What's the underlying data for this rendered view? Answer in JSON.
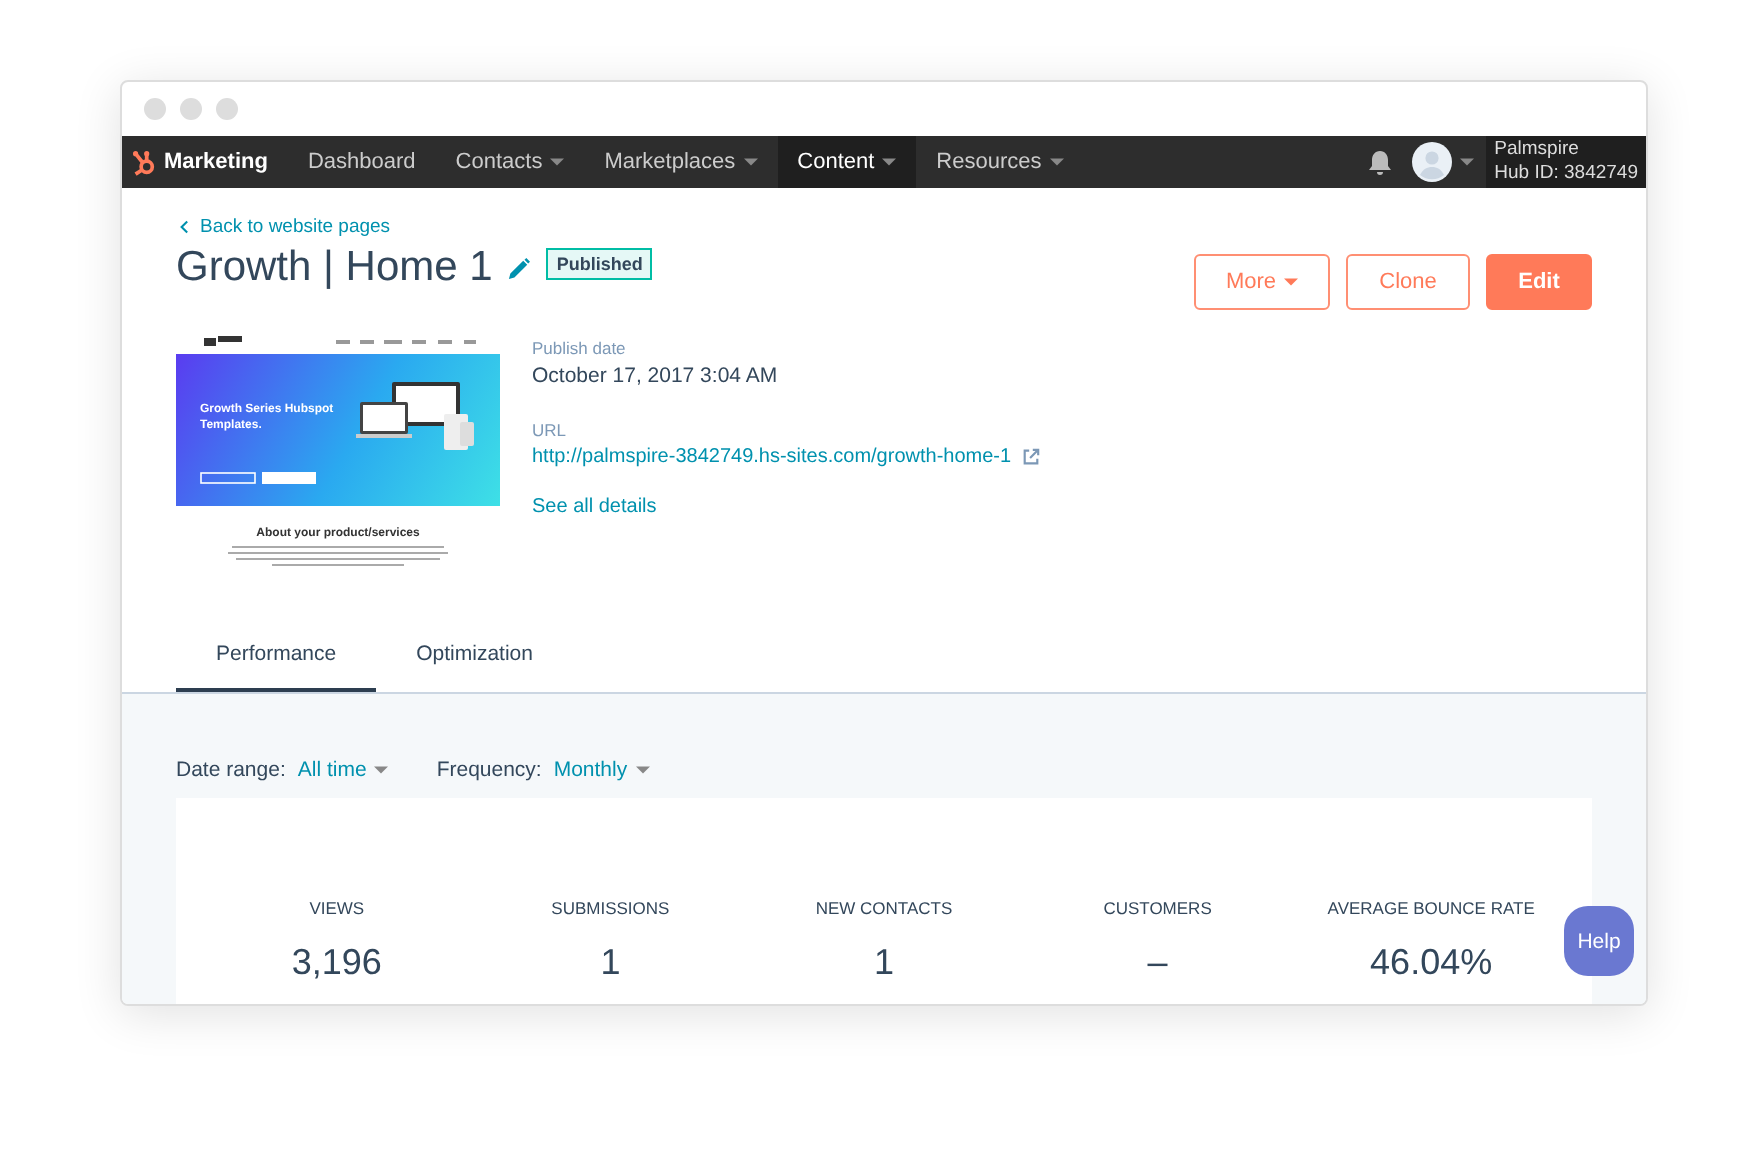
{
  "nav": {
    "brand": "Marketing",
    "items": [
      {
        "label": "Dashboard",
        "dropdown": false,
        "selected": false
      },
      {
        "label": "Contacts",
        "dropdown": true,
        "selected": false
      },
      {
        "label": "Marketplaces",
        "dropdown": true,
        "selected": false
      },
      {
        "label": "Content",
        "dropdown": true,
        "selected": true
      },
      {
        "label": "Resources",
        "dropdown": true,
        "selected": false
      }
    ],
    "account": {
      "name": "Palmspire",
      "hub_id": "Hub ID: 3842749"
    }
  },
  "back_link": "Back to website pages",
  "page_title": "Growth | Home 1",
  "status_badge": "Published",
  "actions": [
    {
      "label": "More",
      "kind": "dropdown"
    },
    {
      "label": "Clone",
      "kind": "secondary"
    },
    {
      "label": "Edit",
      "kind": "primary"
    }
  ],
  "preview": {
    "headline": "Growth Series Hubspot Templates.",
    "section_title": "About your product/services"
  },
  "details": [
    {
      "label": "Publish date",
      "value": "October 17, 2017 3:04 AM",
      "kind": "text"
    },
    {
      "label": "URL",
      "value": "http://palmspire-3842749.hs-sites.com/growth-home-1",
      "kind": "link"
    }
  ],
  "see_all": "See all details",
  "tabs": [
    {
      "label": "Performance",
      "selected": true
    },
    {
      "label": "Optimization",
      "selected": false
    }
  ],
  "filters": [
    {
      "label": "Date range:",
      "value": "All time"
    },
    {
      "label": "Frequency:",
      "value": "Monthly"
    }
  ],
  "stats": [
    {
      "label": "VIEWS",
      "value": "3,196"
    },
    {
      "label": "SUBMISSIONS",
      "value": "1"
    },
    {
      "label": "NEW CONTACTS",
      "value": "1"
    },
    {
      "label": "CUSTOMERS",
      "value": "–"
    },
    {
      "label": "AVERAGE BOUNCE RATE",
      "value": "46.04%"
    }
  ],
  "help": "Help"
}
